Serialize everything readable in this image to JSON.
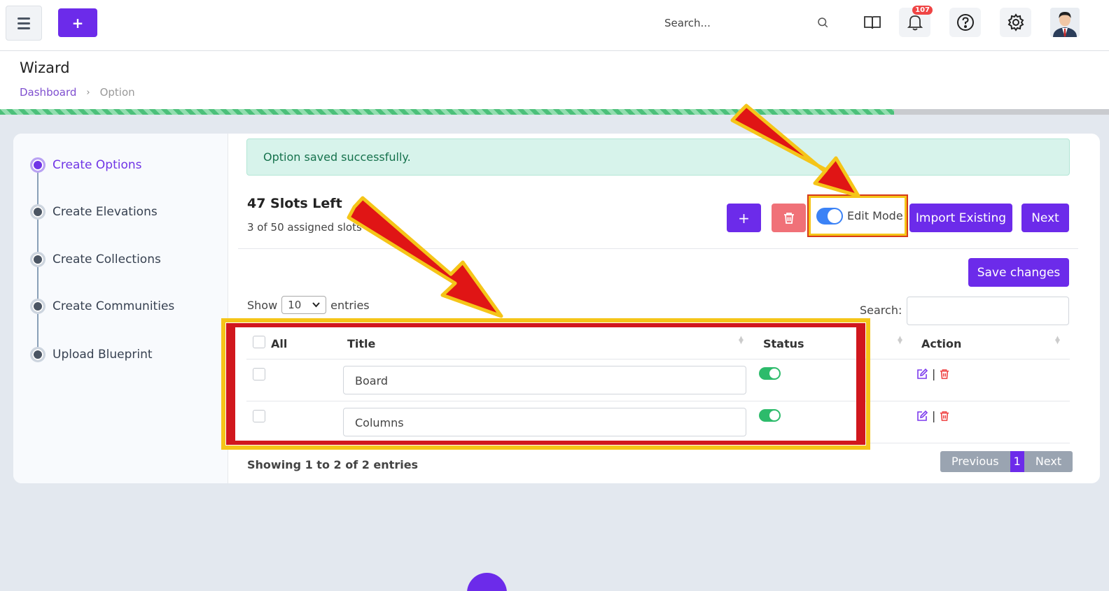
{
  "topbar": {
    "add_label": "+",
    "search_placeholder": "Search...",
    "notification_count": "107",
    "icons": [
      "hamburger-icon",
      "book-icon",
      "bell-icon",
      "help-icon",
      "gear-icon"
    ]
  },
  "header": {
    "title": "Wizard",
    "breadcrumb": {
      "home": "Dashboard",
      "separator": "›",
      "current": "Option"
    }
  },
  "progress": {
    "percent": 80.6
  },
  "steps": [
    {
      "label": "Create Options",
      "active": true
    },
    {
      "label": "Create Elevations",
      "active": false
    },
    {
      "label": "Create Collections",
      "active": false
    },
    {
      "label": "Create Communities",
      "active": false
    },
    {
      "label": "Upload Blueprint",
      "active": false
    }
  ],
  "main": {
    "alert": "Option saved successfully.",
    "slots_title": "47 Slots Left",
    "slots_sub": "3 of 50 assigned slots u",
    "add_label": "+",
    "edit_mode_label": "Edit Mode",
    "import_label": "Import Existing",
    "next_label": "Next",
    "save_label": "Save changes",
    "show_label": "Show",
    "entries_value": "10",
    "entries_label": "entries",
    "search_label": "Search:"
  },
  "table": {
    "headers": {
      "all": "All",
      "title": "Title",
      "status": "Status",
      "action": "Action"
    },
    "rows": [
      {
        "title": "Board",
        "status": "on"
      },
      {
        "title": "Columns",
        "status": "on"
      }
    ],
    "action_separator": "|"
  },
  "footer": {
    "showing": "Showing 1 to 2 of 2 entries",
    "previous": "Previous",
    "page": "1",
    "next": "Next"
  },
  "colors": {
    "primary": "#6c2bea",
    "danger": "#f07178",
    "success": "#2dbb6b",
    "annotation_red": "#d1171d",
    "annotation_yellow": "#f5c518"
  }
}
